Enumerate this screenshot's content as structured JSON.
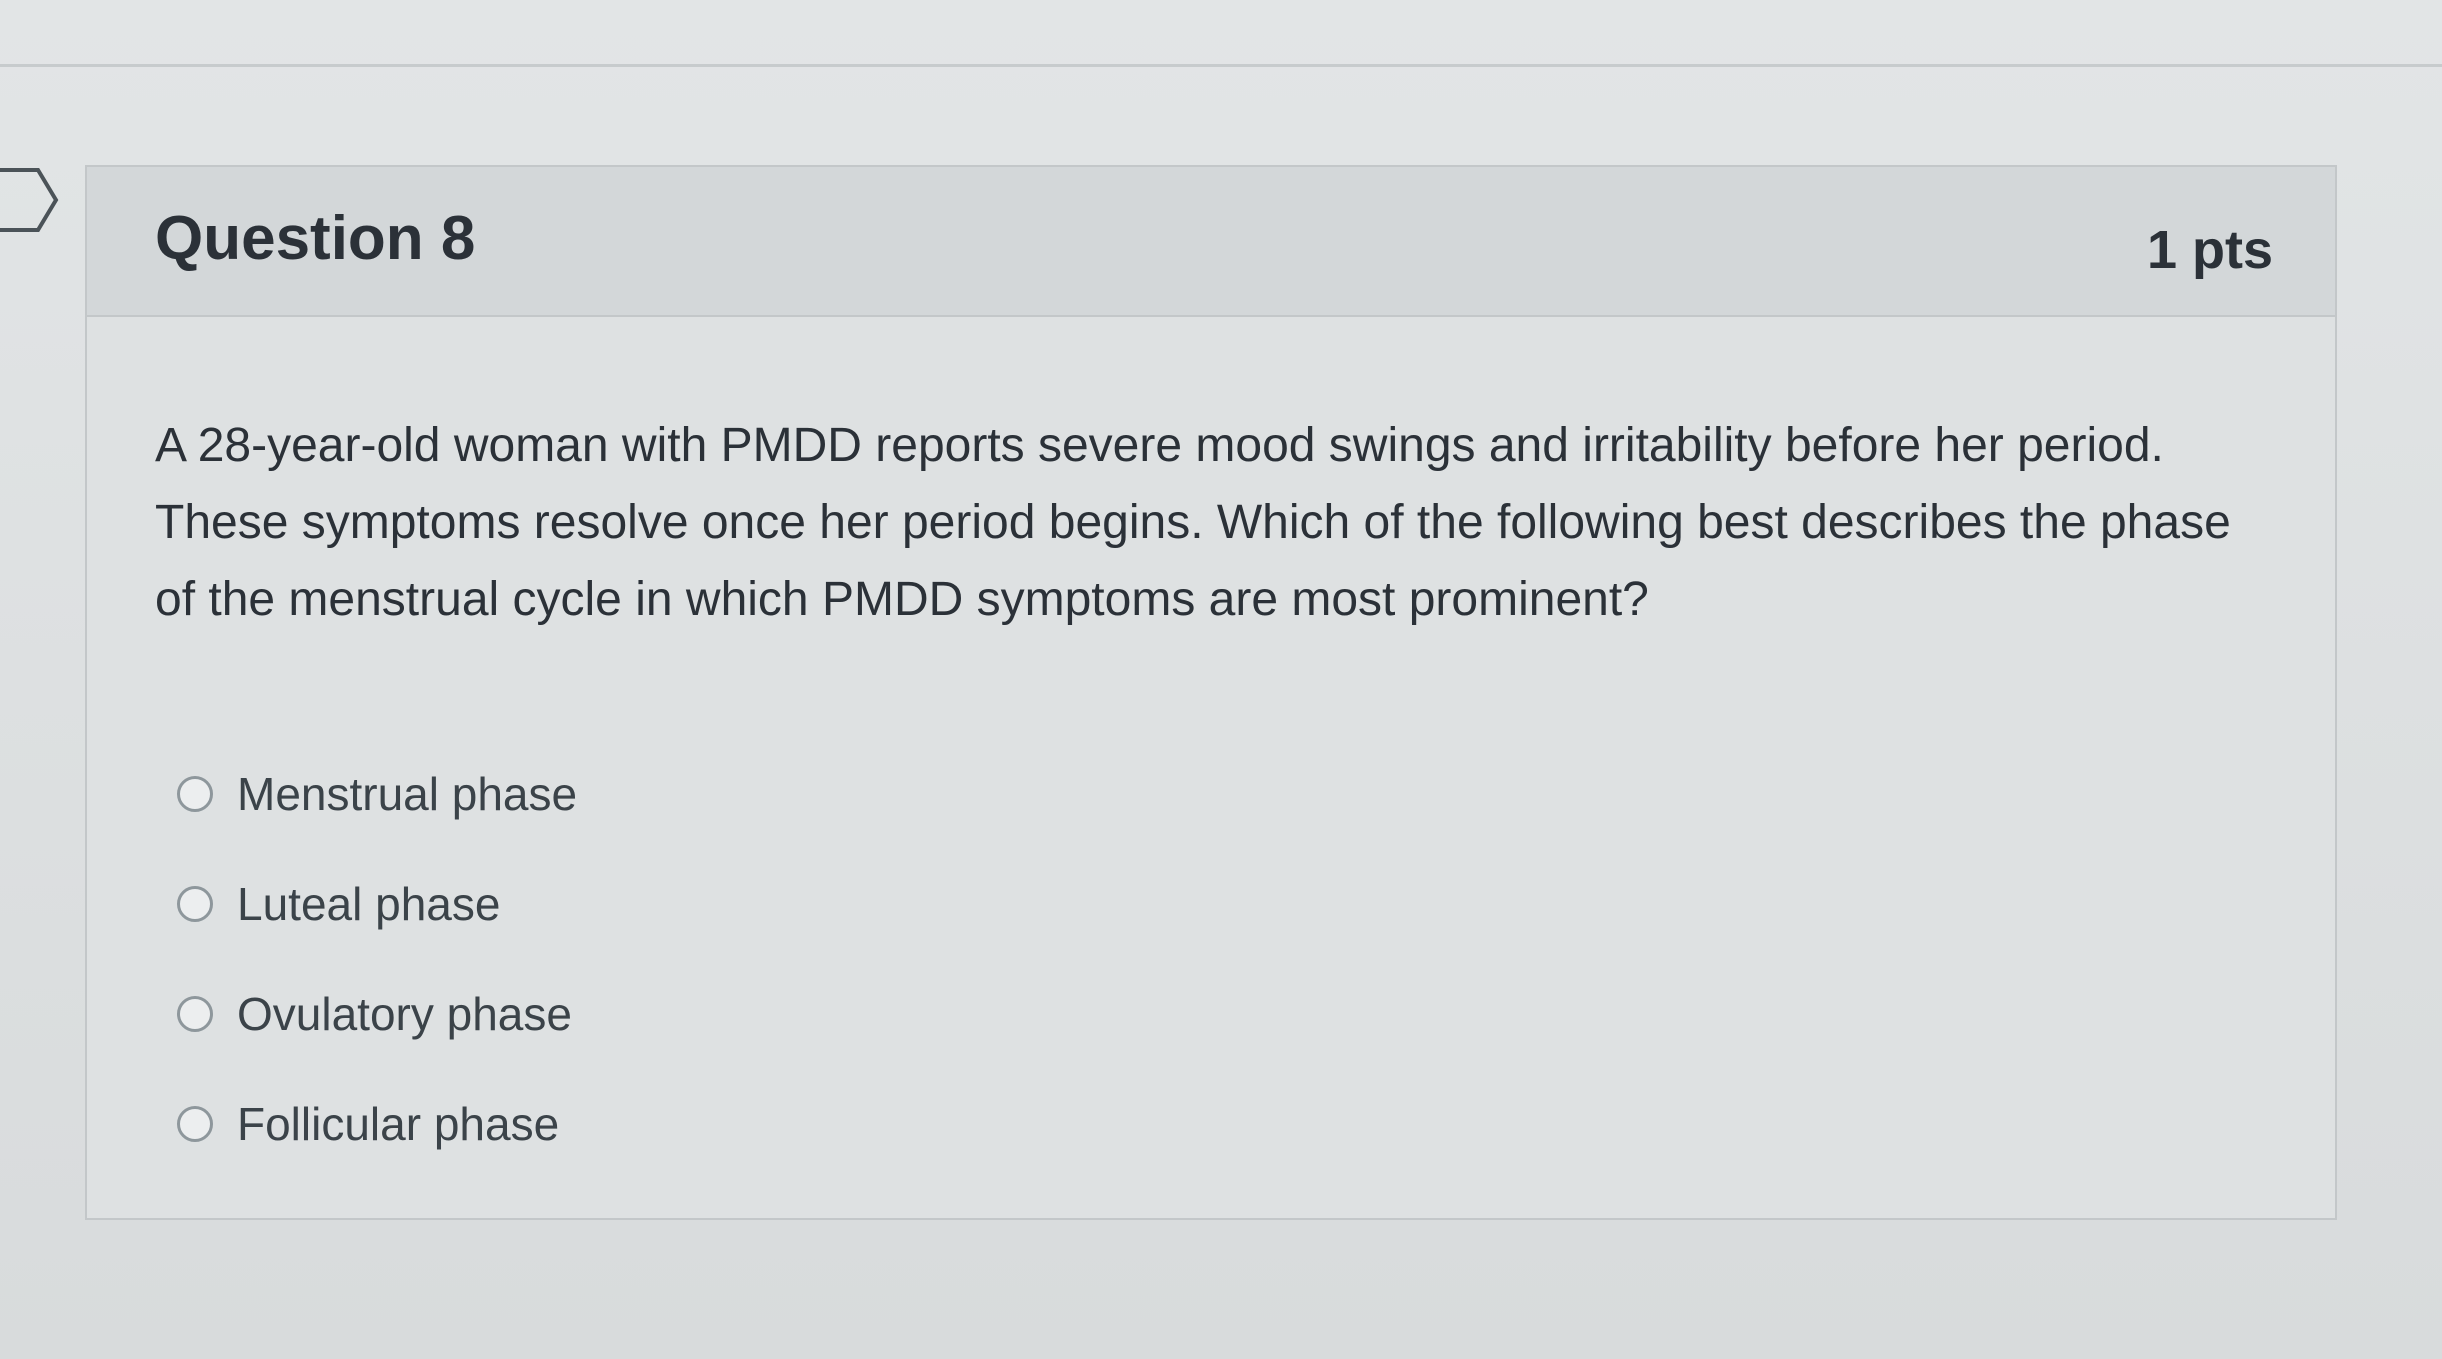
{
  "question": {
    "title": "Question 8",
    "points": "1 pts",
    "text": "A 28-year-old woman with PMDD reports severe mood swings and irritability before her period. These symptoms resolve once her period begins. Which of the following best describes the phase of the menstrual cycle in which PMDD symptoms are most prominent?",
    "answers": [
      {
        "label": "Menstrual phase",
        "selected": false
      },
      {
        "label": "Luteal phase",
        "selected": false
      },
      {
        "label": "Ovulatory phase",
        "selected": false
      },
      {
        "label": "Follicular phase",
        "selected": false
      }
    ]
  },
  "icons": {
    "flag": "bookmark-flag-icon",
    "radio": "radio-button-icon"
  },
  "colors": {
    "text": "#2b3138",
    "border": "#c3c7c9",
    "header_bg": "#d3d7d9"
  }
}
